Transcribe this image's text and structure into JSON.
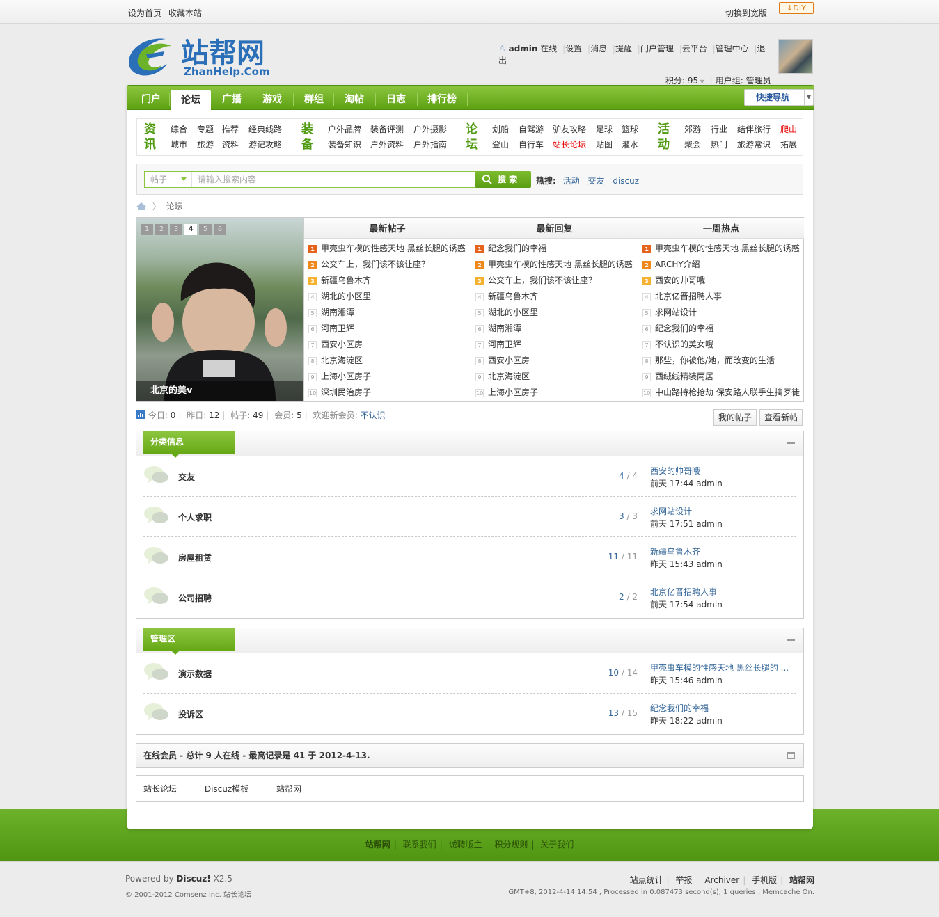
{
  "topbar": {
    "set_home": "设为首页",
    "bookmark": "收藏本站",
    "wide": "切换到宽版",
    "diy": "DIY"
  },
  "logo": {
    "cn": "站帮网",
    "en": "ZhanHelp.Com"
  },
  "user": {
    "name": "admin",
    "status": "在线",
    "links": [
      "设置",
      "消息",
      "提醒",
      "门户管理",
      "云平台",
      "管理中心",
      "退出"
    ],
    "points": "积分: 95",
    "group": "用户组: 管理员"
  },
  "nav": {
    "items": [
      "门户",
      "论坛",
      "广播",
      "游戏",
      "群组",
      "淘帖",
      "日志",
      "排行榜"
    ],
    "active": "论坛",
    "quick": "快捷导航"
  },
  "subnav": {
    "groups": [
      {
        "cat": [
          "资",
          "讯"
        ],
        "row1": [
          "综合",
          "专题",
          "推荐",
          "经典线路"
        ],
        "row2": [
          "城市",
          "旅游",
          "资料",
          "游记攻略"
        ]
      },
      {
        "cat": [
          "装",
          "备"
        ],
        "row1": [
          "户外品牌",
          "装备评测",
          "户外摄影"
        ],
        "row2": [
          "装备知识",
          "户外资料",
          "户外指南"
        ]
      },
      {
        "cat": [
          "论",
          "坛"
        ],
        "row1": [
          "划船",
          "自驾游",
          "驴友攻略",
          "足球",
          "篮球"
        ],
        "row2": [
          "登山",
          "自行车",
          "站长论坛",
          "贴图",
          "灌水"
        ]
      },
      {
        "cat": [
          "活",
          "动"
        ],
        "row1": [
          "郊游",
          "行业",
          "结伴旅行",
          "爬山"
        ],
        "row2": [
          "聚会",
          "热门",
          "旅游常识",
          "拓展"
        ]
      }
    ],
    "red": [
      "站长论坛",
      "爬山"
    ]
  },
  "search": {
    "type": "帖子",
    "placeholder": "请输入搜索内容",
    "button": "搜 索",
    "hot_label": "热搜:",
    "hot": [
      "活动",
      "交友",
      "discuz"
    ]
  },
  "breadcrumb": {
    "current": "论坛"
  },
  "slider": {
    "tabs": [
      "1",
      "2",
      "3",
      "4",
      "5",
      "6"
    ],
    "active": "4",
    "caption": "北京的美v"
  },
  "columns": [
    {
      "title": "最新帖子",
      "items": [
        "甲壳虫车模的性感天地 黑丝长腿的诱惑",
        "公交车上，我们该不该让座？",
        "新疆乌鲁木齐",
        "湖北的小区里",
        "湖南湘潭",
        "河南卫辉",
        "西安小区房",
        "北京海淀区",
        "上海小区房子",
        "深圳民治房子"
      ]
    },
    {
      "title": "最新回复",
      "items": [
        "纪念我们的幸福",
        "甲壳虫车模的性感天地 黑丝长腿的诱惑",
        "公交车上，我们该不该让座？",
        "新疆乌鲁木齐",
        "湖北的小区里",
        "湖南湘潭",
        "河南卫辉",
        "西安小区房",
        "北京海淀区",
        "上海小区房子"
      ]
    },
    {
      "title": "一周热点",
      "items": [
        "甲壳虫车模的性感天地 黑丝长腿的诱惑",
        "ARCHY介绍",
        "西安的帅哥哦",
        "北京亿晋招聘人事",
        "求网站设计",
        "纪念我们的幸福",
        "不认识的美女哦",
        "那些，你被他/她，而改变的生活",
        "西绒线精装两居",
        "中山路持枪抢劫 保安路人联手生擒歹徒"
      ]
    }
  ],
  "stats": {
    "today_label": "今日:",
    "today": "0",
    "yesterday_label": "昨日:",
    "yesterday": "12",
    "posts_label": "帖子:",
    "posts": "49",
    "members_label": "会员:",
    "members": "5",
    "welcome": "欢迎新会员:",
    "newest": "不认识",
    "my_posts": "我的帖子",
    "new_posts": "查看新帖"
  },
  "category1": {
    "title": "分类信息",
    "forums": [
      {
        "name": "交友",
        "threads": "4",
        "posts": "4",
        "last": "西安的帅哥哦",
        "time": "前天 17:44 admin"
      },
      {
        "name": "个人求职",
        "threads": "3",
        "posts": "3",
        "last": "求网站设计",
        "time": "前天 17:51 admin"
      },
      {
        "name": "房屋租赁",
        "threads": "11",
        "posts": "11",
        "last": "新疆乌鲁木齐",
        "time": "昨天 15:43 admin"
      },
      {
        "name": "公司招聘",
        "threads": "2",
        "posts": "2",
        "last": "北京亿晋招聘人事",
        "time": "前天 17:54 admin"
      }
    ]
  },
  "category2": {
    "title": "管理区",
    "forums": [
      {
        "name": "演示数据",
        "threads": "10",
        "posts": "14",
        "last": "甲壳虫车模的性感天地 黑丝长腿的 ...",
        "time": "昨天 15:46 admin"
      },
      {
        "name": "投诉区",
        "threads": "13",
        "posts": "15",
        "last": "纪念我们的幸福",
        "time": "昨天 18:22 admin"
      }
    ]
  },
  "online": "在线会员 - 总计 9 人在线 - 最高记录是 41 于 2012-4-13.",
  "friend_links": [
    "站长论坛",
    "Discuz模板",
    "站帮网"
  ],
  "footer_links": [
    "站帮网",
    "联系我们",
    "诚聘版主",
    "积分规则",
    "关于我们"
  ],
  "footer": {
    "powered": "Powered by",
    "discuz": "Discuz!",
    "version": "X2.5",
    "copy": "© 2001-2012 Comsenz Inc. 站长论坛",
    "right_links": [
      "站点统计",
      "举报",
      "Archiver",
      "手机版",
      "站帮网"
    ],
    "gmt": "GMT+8, 2012-4-14 14:54 , Processed in 0.087473 second(s), 1 queries , Memcache On."
  },
  "colors": {
    "green": "#6fb129",
    "link": "#336699",
    "red": "#e60000"
  }
}
